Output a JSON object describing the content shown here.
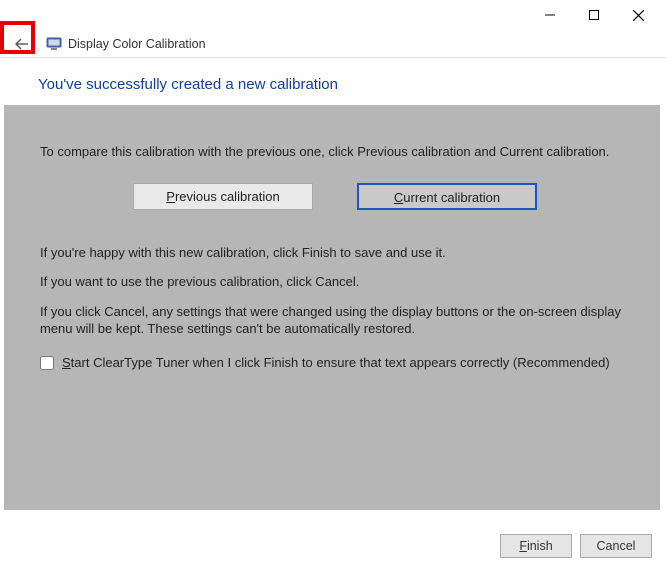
{
  "header": {
    "app_title": "Display Color Calibration"
  },
  "page": {
    "title": "You've successfully created a new calibration"
  },
  "body": {
    "compare_intro": "To compare this calibration with the previous one, click Previous calibration and Current calibration.",
    "prev_btn_prefix": "P",
    "prev_btn_rest": "revious calibration",
    "cur_btn_prefix": "C",
    "cur_btn_rest": "urrent calibration",
    "happy_line": "If you're happy with this new calibration, click Finish to save and use it.",
    "use_prev_line": "If you want to use the previous calibration, click Cancel.",
    "cancel_note": "If you click Cancel, any settings that were changed using the display buttons or the on-screen display menu will be kept. These settings can't be automatically restored.",
    "cleartype_prefix": "S",
    "cleartype_rest": "tart ClearType Tuner when I click Finish to ensure that text appears correctly (Recommended)"
  },
  "footer": {
    "finish_prefix": "F",
    "finish_rest": "inish",
    "cancel": "Cancel"
  }
}
